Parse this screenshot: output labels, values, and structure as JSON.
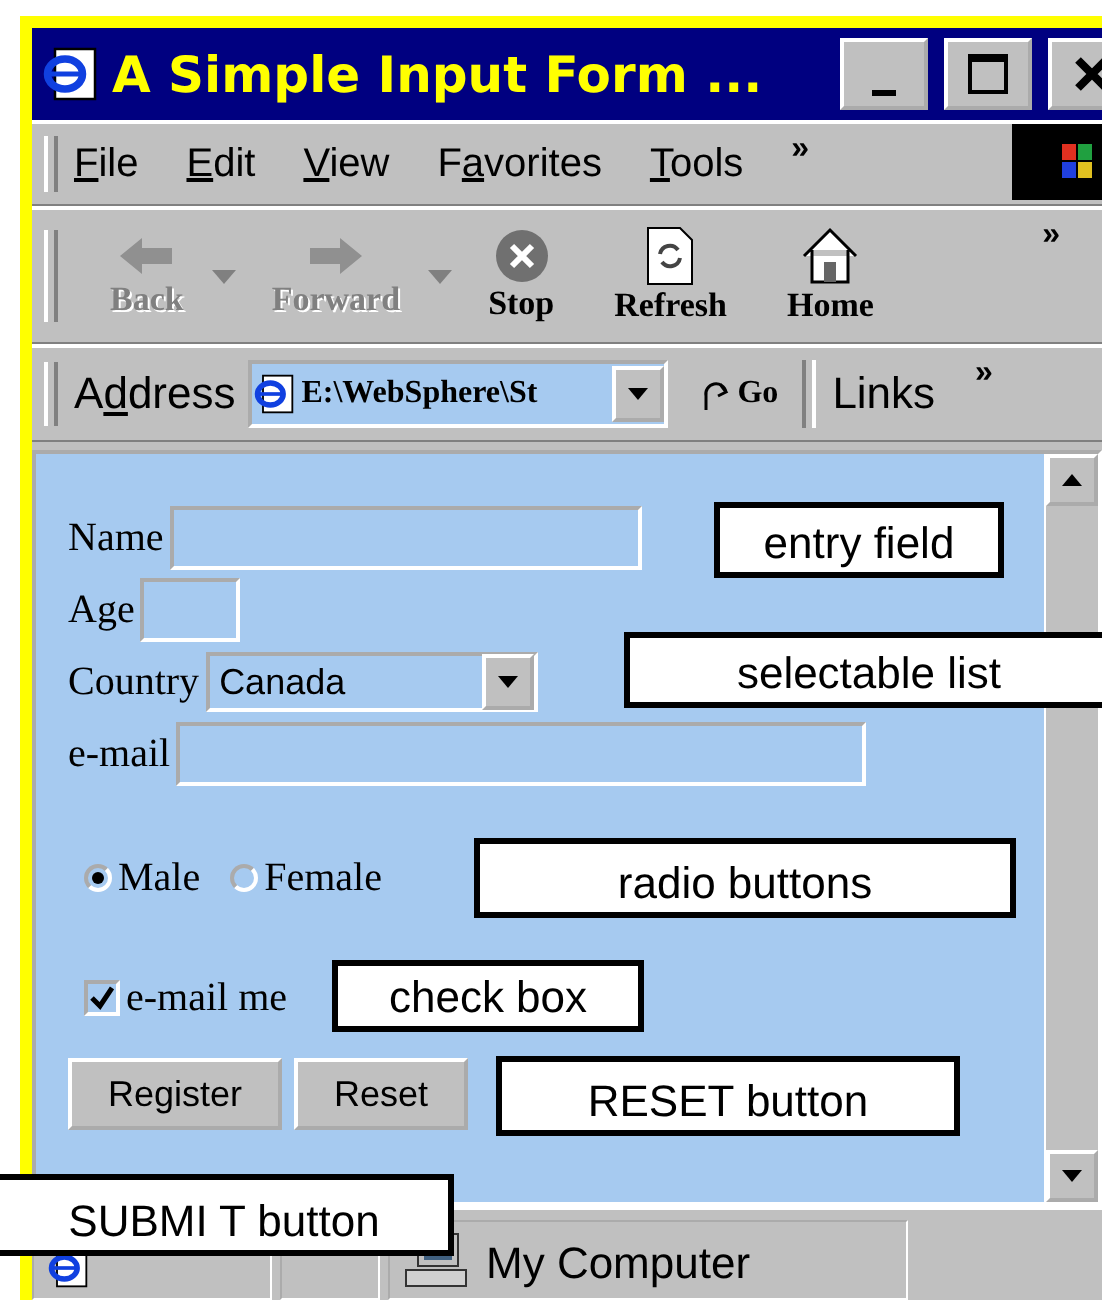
{
  "window": {
    "title": "A Simple Input Form ..."
  },
  "menu": {
    "items": [
      {
        "key": "F",
        "after": "ile"
      },
      {
        "key": "E",
        "after": "dit"
      },
      {
        "key": "V",
        "after": "iew"
      },
      {
        "before": "F",
        "key": "a",
        "after": "vorites"
      },
      {
        "key": "T",
        "after": "ools"
      }
    ],
    "more": "»"
  },
  "toolbar": {
    "buttons": [
      {
        "label": "Back",
        "kind": "back",
        "disabled": true
      },
      {
        "label": "Forward",
        "kind": "forward",
        "disabled": true
      },
      {
        "label": "Stop",
        "kind": "stop",
        "disabled": false
      },
      {
        "label": "Refresh",
        "kind": "refresh",
        "disabled": false
      },
      {
        "label": "Home",
        "kind": "home",
        "disabled": false
      }
    ],
    "more": "»"
  },
  "address_bar": {
    "label": {
      "before": "A",
      "key": "d",
      "after": "dress"
    },
    "value": "E:\\WebSphere\\St",
    "go": "Go",
    "links": "Links",
    "more": "»"
  },
  "form": {
    "fields": [
      {
        "label": "Name",
        "kind": "text"
      },
      {
        "label": "Age",
        "kind": "text"
      },
      {
        "label": "Country",
        "kind": "select",
        "value": "Canada"
      },
      {
        "label": "e-mail",
        "kind": "text"
      }
    ],
    "radios": [
      {
        "label": "Male",
        "selected": true
      },
      {
        "label": "Female",
        "selected": false
      }
    ],
    "checkbox": {
      "label": "e-mail me",
      "checked": true
    },
    "buttons": [
      "Register",
      "Reset"
    ]
  },
  "callouts": [
    {
      "text": "entry field"
    },
    {
      "text": "selectable list"
    },
    {
      "text": "radio buttons"
    },
    {
      "text": "check box"
    },
    {
      "text": "RESET button"
    },
    {
      "text": "SUBMI T button"
    }
  ],
  "status_bar": {
    "zone": "My Computer"
  }
}
